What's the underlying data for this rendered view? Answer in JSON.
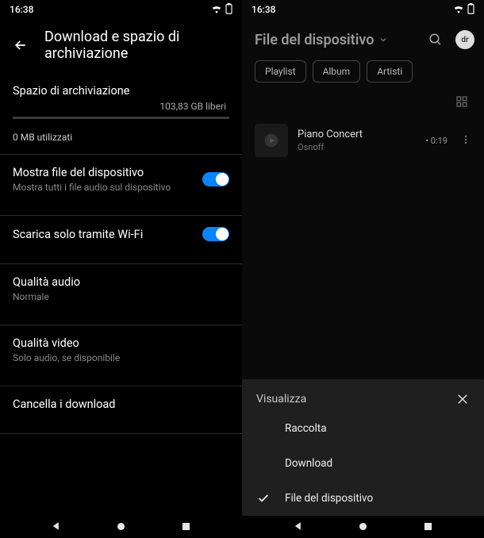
{
  "left": {
    "time": "16:38",
    "title": "Download e spazio di archiviazione",
    "storage": {
      "header": "Spazio di archiviazione",
      "free": "103,83 GB liberi",
      "used": "0 MB utilizzati"
    },
    "rows": {
      "show_files": {
        "title": "Mostra file del dispositivo",
        "sub": "Mostra tutti i file audio sul dispositivo"
      },
      "wifi_only": {
        "title": "Scarica solo tramite Wi-Fi"
      },
      "audio_quality": {
        "title": "Qualità audio",
        "sub": "Normale"
      },
      "video_quality": {
        "title": "Qualità video",
        "sub": "Solo audio, se disponibile"
      },
      "clear": {
        "title": "Cancella i download"
      }
    }
  },
  "right": {
    "time": "16:38",
    "title": "File del dispositivo",
    "avatar": "dr",
    "tabs": [
      "Playlist",
      "Album",
      "Artisti"
    ],
    "track": {
      "title": "Piano Concert",
      "artist": "Osnoff",
      "duration": "• 0:19"
    },
    "overlay": {
      "title": "Visualizza",
      "items": [
        "Raccolta",
        "Download",
        "File del dispositivo"
      ]
    }
  }
}
